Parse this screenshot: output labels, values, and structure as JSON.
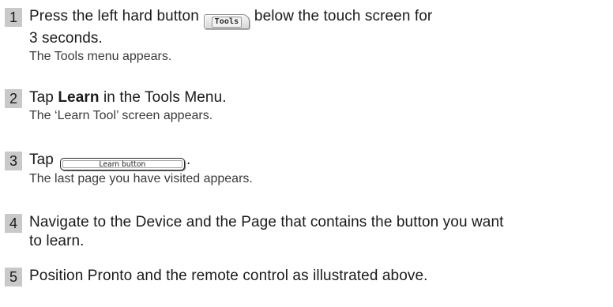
{
  "steps": [
    {
      "number": "1",
      "line1_before": "Press the left hard button",
      "inline_button_label": "Tools",
      "line1_after": "below the touch screen for",
      "line2": "3 seconds.",
      "result": "The Tools menu appears."
    },
    {
      "number": "2",
      "text_before": "Tap",
      "bold": "Learn",
      "text_after": "in the Tools Menu.",
      "result": "The ‘Learn Tool’ screen appears."
    },
    {
      "number": "3",
      "text_before": "Tap",
      "inline_button_label": "Learn button",
      "text_after": ".",
      "result": "The last page you have visited appears."
    },
    {
      "number": "4",
      "line1": "Navigate to the Device and the Page that contains the button you want",
      "line2": "to learn."
    },
    {
      "number": "5",
      "line1": "Position Pronto and the remote control as illustrated above."
    }
  ]
}
